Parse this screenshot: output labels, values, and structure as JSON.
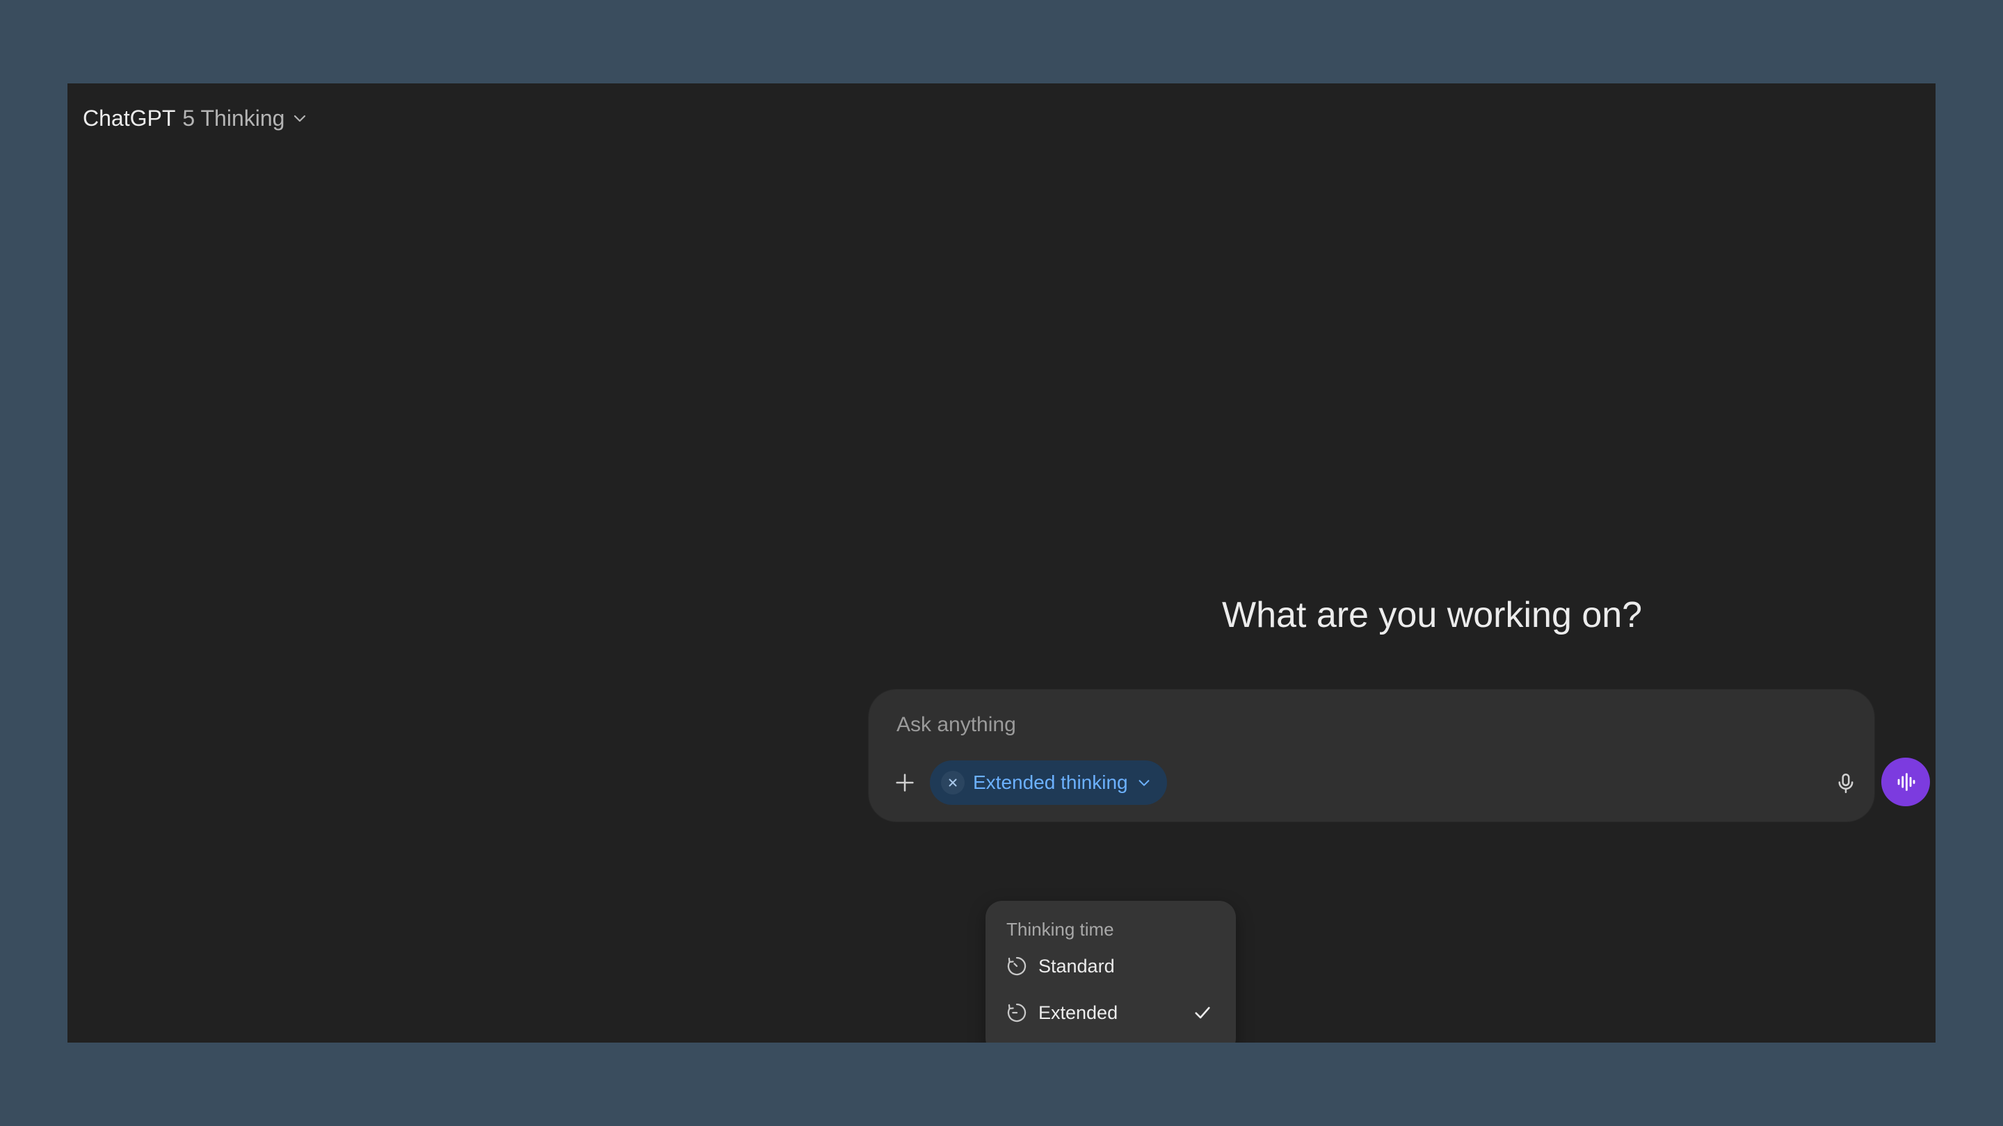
{
  "header": {
    "brand": "ChatGPT",
    "model": "5 Thinking",
    "chevron_icon": "chevron-down-icon"
  },
  "main": {
    "headline": "What are you working on?"
  },
  "composer": {
    "placeholder": "Ask anything",
    "value": "",
    "plus_icon": "plus-icon",
    "tool_pill": {
      "label": "Extended thinking",
      "remove_icon": "close-icon",
      "chevron_icon": "chevron-down-icon"
    },
    "mic_icon": "microphone-icon",
    "voice_icon": "voice-waveform-icon"
  },
  "thinking_menu": {
    "heading": "Thinking time",
    "options": [
      {
        "label": "Standard",
        "icon": "timer-icon",
        "selected": false
      },
      {
        "label": "Extended",
        "icon": "timer-icon",
        "selected": true
      }
    ]
  },
  "colors": {
    "page_background": "#3a4d5e",
    "window_background": "#212121",
    "composer_background": "#303030",
    "pill_background": "#1f3a56",
    "pill_text": "#6cb1ff",
    "voice_button": "#7c3bdf",
    "menu_background": "#353535"
  }
}
